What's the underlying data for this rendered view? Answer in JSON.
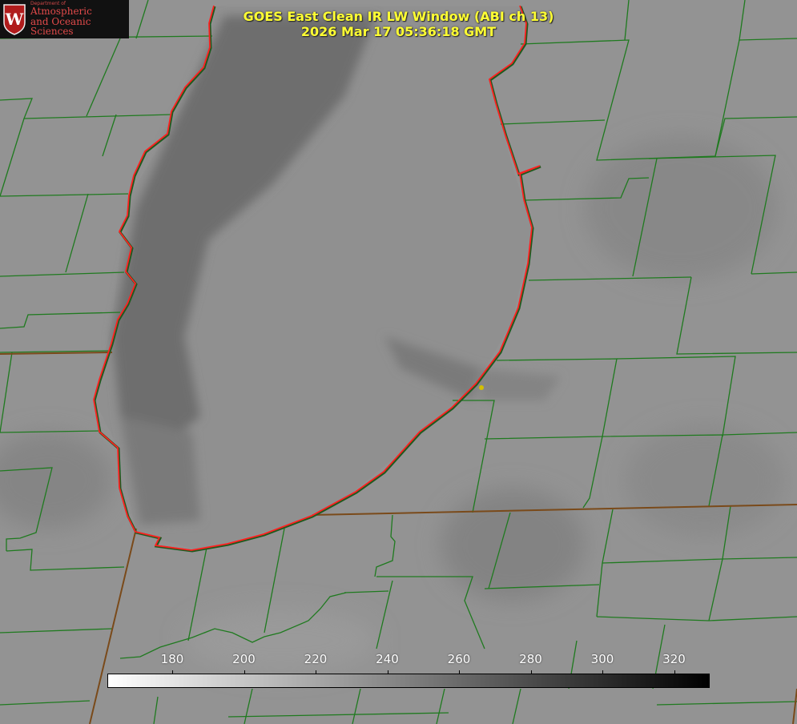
{
  "header": {
    "title_line1": "GOES East Clean IR LW Window (ABI ch 13)",
    "title_line2": "2026 Mar 17 05:36:18 GMT"
  },
  "logo": {
    "dept": "Department of",
    "line1": "Atmospheric",
    "line2": "and Oceanic Sciences",
    "crest_letter": "W",
    "icon": "uw-crest-icon"
  },
  "colorbar": {
    "ticks": [
      "180",
      "200",
      "220",
      "240",
      "260",
      "280",
      "300",
      "320"
    ],
    "gradient_from": "#ffffff",
    "gradient_to": "#000000"
  },
  "colors": {
    "county_lines": "#1f7a1f",
    "lake_outline": "#ff2020",
    "state_line": "#8b3a1a",
    "title_text": "#ffff33",
    "marker": "#d4c000"
  }
}
